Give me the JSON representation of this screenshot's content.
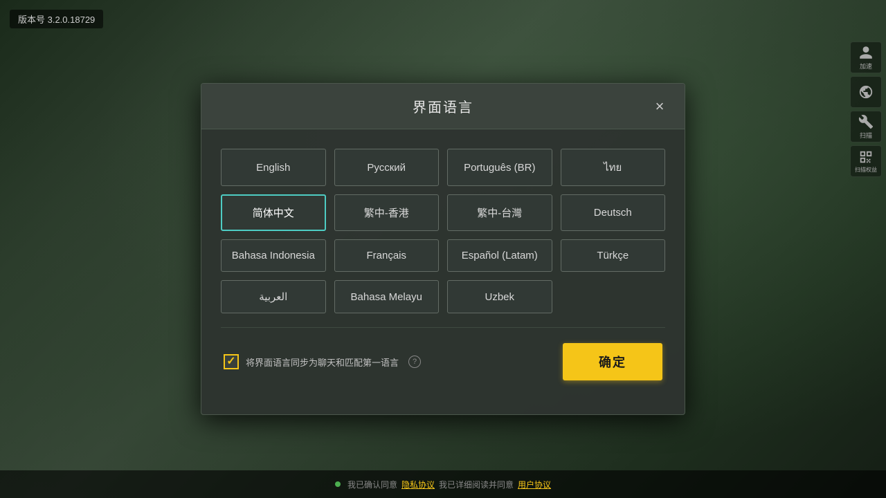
{
  "app": {
    "version": "版本号 3.2.0.18729"
  },
  "dialog": {
    "title": "界面语言",
    "close_label": "×",
    "languages": [
      {
        "id": "english",
        "label": "English",
        "selected": false
      },
      {
        "id": "russian",
        "label": "Русский",
        "selected": false
      },
      {
        "id": "portuguese_br",
        "label": "Português (BR)",
        "selected": false
      },
      {
        "id": "thai",
        "label": "ไทย",
        "selected": false
      },
      {
        "id": "simplified_chinese",
        "label": "简体中文",
        "selected": true
      },
      {
        "id": "traditional_hk",
        "label": "繁中-香港",
        "selected": false
      },
      {
        "id": "traditional_tw",
        "label": "繁中-台灣",
        "selected": false
      },
      {
        "id": "german",
        "label": "Deutsch",
        "selected": false
      },
      {
        "id": "indonesian",
        "label": "Bahasa Indonesia",
        "selected": false
      },
      {
        "id": "french",
        "label": "Français",
        "selected": false
      },
      {
        "id": "spanish_latam",
        "label": "Español (Latam)",
        "selected": false
      },
      {
        "id": "turkish",
        "label": "Türkçe",
        "selected": false
      },
      {
        "id": "arabic",
        "label": "العربية",
        "selected": false
      },
      {
        "id": "malay",
        "label": "Bahasa Melayu",
        "selected": false
      },
      {
        "id": "uzbek",
        "label": "Uzbek",
        "selected": false
      }
    ],
    "sync_checkbox": {
      "checked": true,
      "label": "将界面语言同步为聊天和匹配第一语言"
    },
    "confirm_label": "确定",
    "help_tooltip": "?"
  },
  "bottom_bar": {
    "privacy_prefix": "我已确认同意",
    "privacy_link": "隐私协议",
    "terms_prefix": "我已详细阅读并同意",
    "terms_link": "用户协议"
  },
  "sidebar": {
    "icons": [
      {
        "id": "user",
        "label": "加速"
      },
      {
        "id": "globe",
        "label": ""
      },
      {
        "id": "wrench",
        "label": "扫描"
      },
      {
        "id": "qrcode",
        "label": "扫描权益"
      }
    ]
  }
}
